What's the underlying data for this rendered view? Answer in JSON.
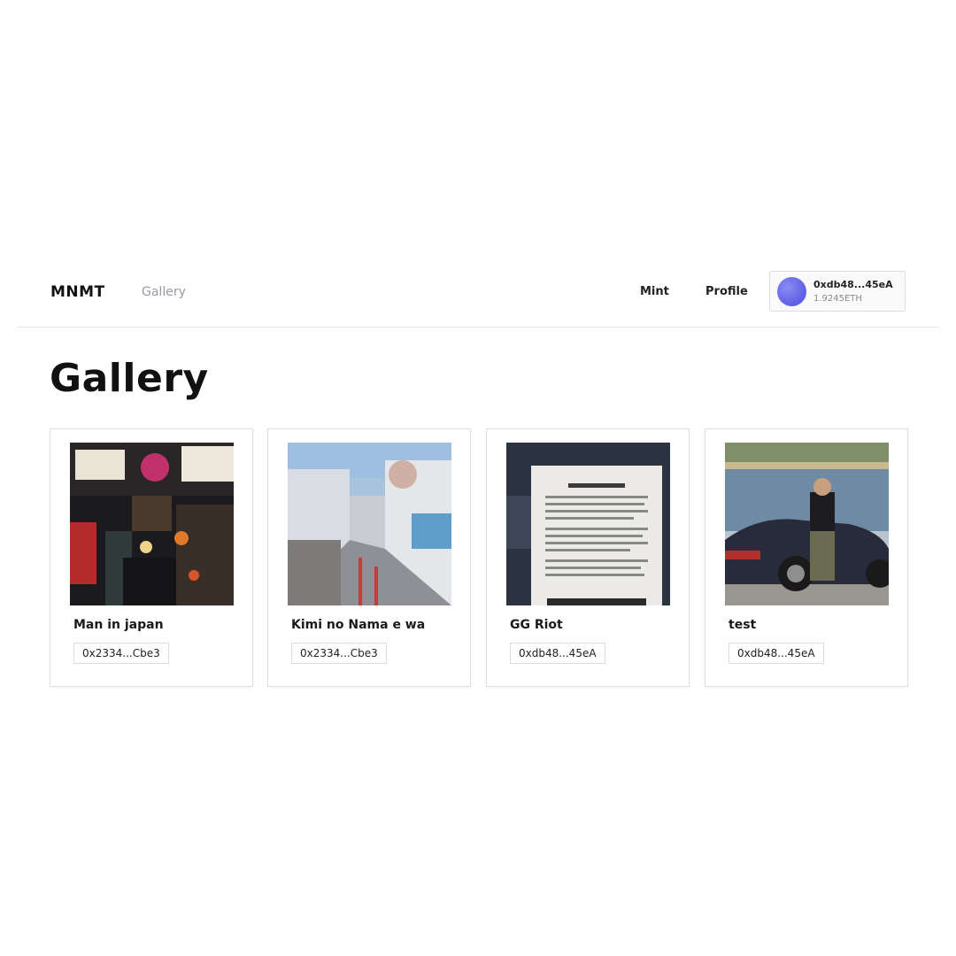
{
  "nav": {
    "brand": "MNMT",
    "gallery_label": "Gallery",
    "mint_label": "Mint",
    "profile_label": "Profile"
  },
  "wallet": {
    "address": "0xdb48...45eA",
    "balance": "1.9245ETH",
    "avatar_color": "#6366f1"
  },
  "page": {
    "title": "Gallery"
  },
  "gallery": {
    "items": [
      {
        "title": "Man in japan",
        "owner": "0x2334...Cbe3",
        "image": "night-alley-lanterns-photo"
      },
      {
        "title": "Kimi no Nama e wa",
        "owner": "0x2334...Cbe3",
        "image": "city-stairs-street-photo"
      },
      {
        "title": "GG Riot",
        "owner": "0xdb48...45eA",
        "image": "account-locked-screen-photo"
      },
      {
        "title": "test",
        "owner": "0xdb48...45eA",
        "image": "man-with-car-photo"
      }
    ]
  }
}
